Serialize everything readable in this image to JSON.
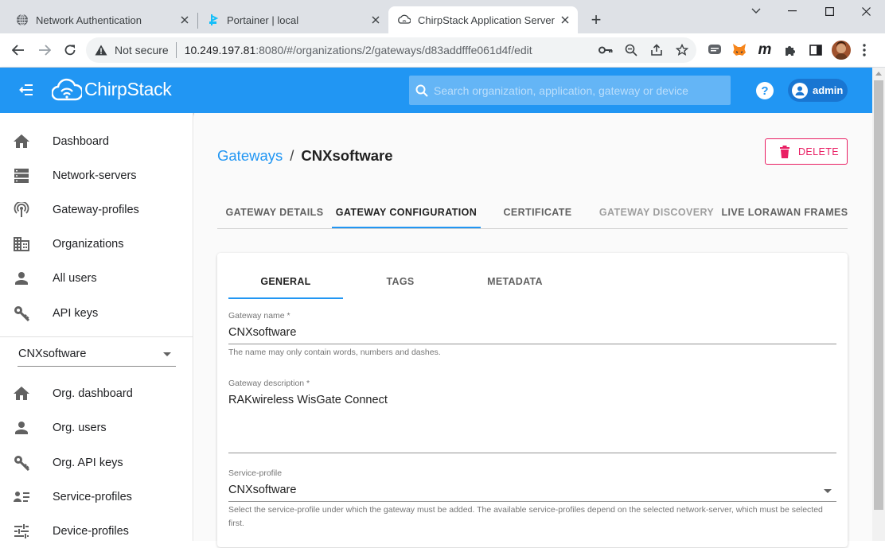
{
  "browser": {
    "tabs": [
      {
        "title": "Network Authentication",
        "icon": "globe-icon"
      },
      {
        "title": "Portainer | local",
        "icon": "portainer-icon"
      },
      {
        "title": "ChirpStack Application Server",
        "icon": "chirpstack-icon",
        "active": true
      }
    ],
    "new_tab_label": "+",
    "security_label": "Not secure",
    "url_host": "10.249.197.81",
    "url_rest": ":8080/#/organizations/2/gateways/d83addfffe061d4f/edit"
  },
  "app": {
    "brand": "ChirpStack",
    "search_placeholder": "Search organization, application, gateway or device",
    "user": "admin",
    "primary_color": "#2196f3",
    "accent_color": "#e91e63"
  },
  "sidebar": {
    "items": [
      {
        "label": "Dashboard",
        "icon": "home-icon"
      },
      {
        "label": "Network-servers",
        "icon": "server-icon"
      },
      {
        "label": "Gateway-profiles",
        "icon": "antenna-icon"
      },
      {
        "label": "Organizations",
        "icon": "domain-icon"
      },
      {
        "label": "All users",
        "icon": "user-icon"
      },
      {
        "label": "API keys",
        "icon": "key-icon"
      }
    ],
    "org_select": "CNXsoftware",
    "org_items": [
      {
        "label": "Org. dashboard",
        "icon": "home-icon"
      },
      {
        "label": "Org. users",
        "icon": "user-icon"
      },
      {
        "label": "Org. API keys",
        "icon": "key-icon"
      },
      {
        "label": "Service-profiles",
        "icon": "account-details-icon"
      },
      {
        "label": "Device-profiles",
        "icon": "tune-icon"
      }
    ]
  },
  "page": {
    "breadcrumb_parent": "Gateways",
    "breadcrumb_sep": "/",
    "breadcrumb_current": "CNXsoftware",
    "delete_label": "DELETE",
    "tabs": [
      "GATEWAY DETAILS",
      "GATEWAY CONFIGURATION",
      "CERTIFICATE",
      "GATEWAY DISCOVERY",
      "LIVE LORAWAN FRAMES"
    ],
    "active_tab": "GATEWAY CONFIGURATION",
    "subtabs": [
      "GENERAL",
      "TAGS",
      "METADATA"
    ],
    "active_subtab": "GENERAL",
    "form": {
      "name_label": "Gateway name *",
      "name_value": "CNXsoftware",
      "name_help": "The name may only contain words, numbers and dashes.",
      "desc_label": "Gateway description *",
      "desc_value": "RAKwireless WisGate Connect",
      "sp_label": "Service-profile",
      "sp_value": "CNXsoftware",
      "sp_help": "Select the service-profile under which the gateway must be added. The available service-profiles depend on the selected network-server, which must be selected first."
    }
  }
}
